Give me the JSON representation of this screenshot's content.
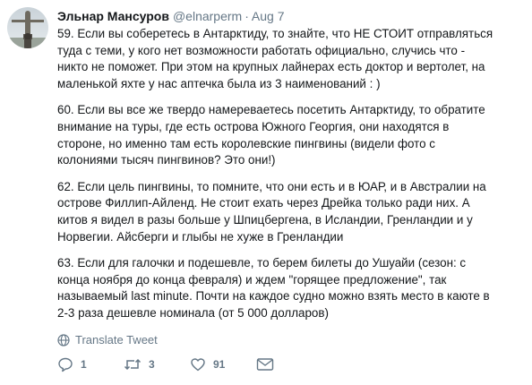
{
  "tweet": {
    "author_name": "Эльнар Мансуров",
    "author_handle": "@elnarperm",
    "separator": "·",
    "date": "Aug 7",
    "paragraphs": [
      "59. Если вы соберетесь в Антарктиду, то знайте, что НЕ СТОИТ отправляться\nтуда с теми, у кого нет возможности работать официально, случись что -\nникто не поможет. При этом на крупных лайнерах есть доктор и вертолет, на\nмаленькой яхте у нас аптечка была из 3 наименований : )",
      "60. Если вы все же твердо намереваетесь посетить Антарктиду, то обратите\nвнимание на туры, где есть острова Южного Георгия, они находятся в\nстороне, но именно там есть королевские пингвины (видели фото с\nколониями тысяч пингвинов? Это они!)",
      "62. Если цель пингвины, то помните, что они есть и в ЮАР, и в Австралии на\nострове Филлип-Айленд. Не стоит ехать через Дрейка только ради них. А\nкитов я видел в разы больше у Шпицбергена, в Исландии, Гренландии и у\nНорвегии. Айсберги и глыбы не хуже в Гренландии",
      "63. Если для галочки и подешевле, то берем билеты до Ушуайи (сезон: с\nконца ноября до конца февраля)  и ждем \"горящее предложение\", так\nназываемый last minute. Почти на каждое судно можно взять место в каюте в\n2-3 раза дешевле номинала (от 5 000 долларов)"
    ],
    "translate_label": "Translate Tweet",
    "replies": "1",
    "retweets": "3",
    "likes": "91"
  },
  "icons": {
    "avatar": "avatar-statue-photo",
    "translate": "globe-icon",
    "reply": "reply-icon",
    "retweet": "retweet-icon",
    "like": "heart-icon",
    "dm": "envelope-icon"
  },
  "colors": {
    "text": "#14171a",
    "secondary": "#657786"
  }
}
